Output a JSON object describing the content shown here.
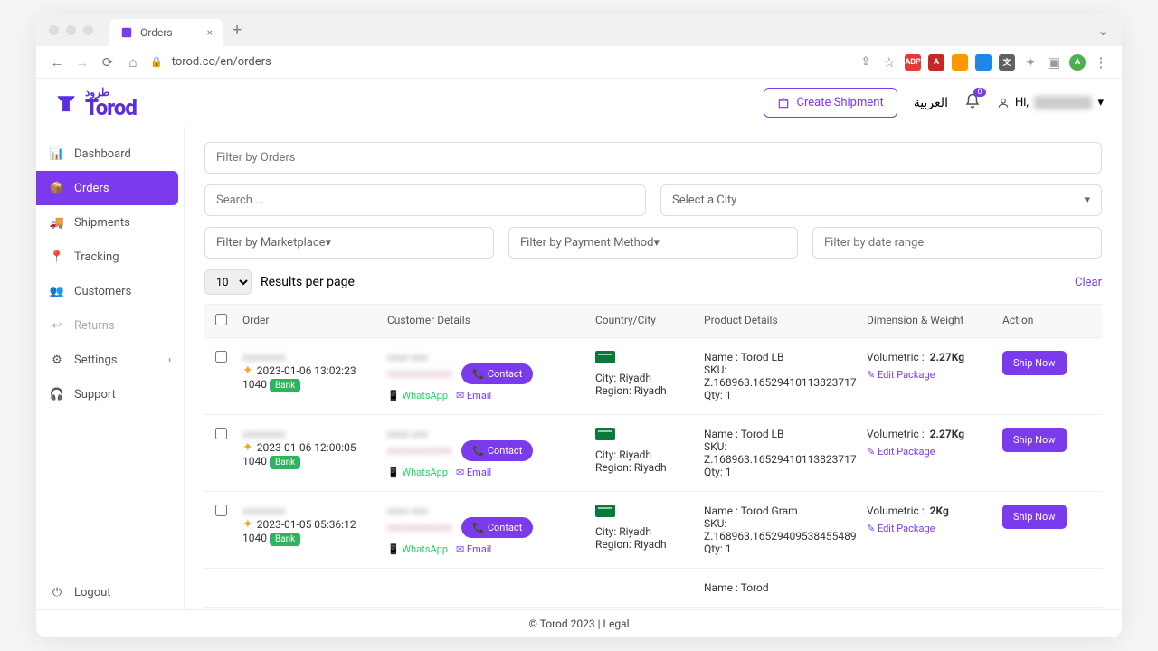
{
  "browser": {
    "tab_title": "Orders",
    "url": "torod.co/en/orders"
  },
  "header": {
    "create_shipment": "Create Shipment",
    "lang": "العربية",
    "notif_count": "0",
    "greeting": "Hi,"
  },
  "sidebar": [
    {
      "label": "Dashboard",
      "active": false
    },
    {
      "label": "Orders",
      "active": true
    },
    {
      "label": "Shipments",
      "active": false
    },
    {
      "label": "Tracking",
      "active": false
    },
    {
      "label": "Customers",
      "active": false
    },
    {
      "label": "Returns",
      "active": false
    },
    {
      "label": "Settings",
      "active": false,
      "chev": true
    },
    {
      "label": "Support",
      "active": false
    }
  ],
  "logout": "Logout",
  "filters": {
    "filter_orders_ph": "Filter by Orders",
    "search_ph": "Search ...",
    "city_ph": "Select a City",
    "marketplace_ph": "Filter by Marketplace",
    "payment_ph": "Filter by Payment Method",
    "daterange_ph": "Filter by date range",
    "page_size": "10",
    "results_label": "Results per page",
    "clear": "Clear"
  },
  "columns": {
    "order": "Order",
    "cust": "Customer Details",
    "loc": "Country/City",
    "prod": "Product Details",
    "dim": "Dimension & Weight",
    "act": "Action"
  },
  "labels": {
    "contact": "Contact",
    "whatsapp": "WhatsApp",
    "email": "Email",
    "ship": "Ship Now",
    "edit": "Edit Package",
    "name_prefix": "Name :",
    "sku_prefix": "SKU:",
    "qty_prefix": "Qty:",
    "vol_prefix": "Volumetric :",
    "city_prefix": "City:",
    "region_prefix": "Region:"
  },
  "rows": [
    {
      "date": "2023-01-06 13:02:23",
      "num": "1040",
      "status": "Bank",
      "city": "Riyadh",
      "region": "Riyadh",
      "pname": "Torod LB",
      "sku": "Z.168963.16529410113823717",
      "qty": "1",
      "weight": "2.27Kg"
    },
    {
      "date": "2023-01-06 12:00:05",
      "num": "1040",
      "status": "Bank",
      "city": "Riyadh",
      "region": "Riyadh",
      "pname": "Torod LB",
      "sku": "Z.168963.16529410113823717",
      "qty": "1",
      "weight": "2.27Kg"
    },
    {
      "date": "2023-01-05 05:36:12",
      "num": "1040",
      "status": "Bank",
      "city": "Riyadh",
      "region": "Riyadh",
      "pname": "Torod Gram",
      "sku": "Z.168963.16529409538455489",
      "qty": "1",
      "weight": "2Kg"
    }
  ],
  "partial_row_name": "Torod",
  "footer": "© Torod 2023 | Legal"
}
